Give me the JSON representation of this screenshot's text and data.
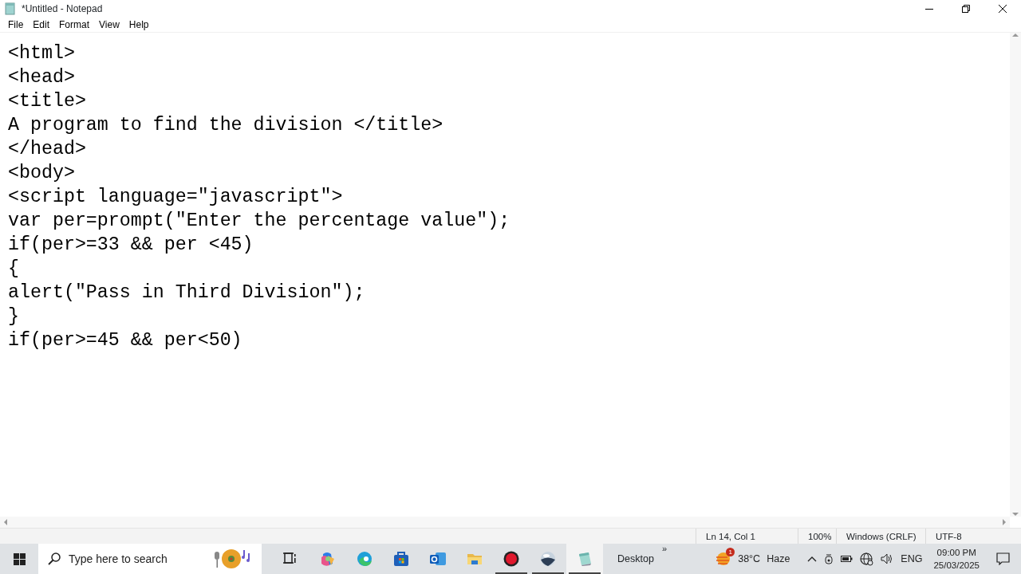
{
  "window": {
    "title": "*Untitled - Notepad"
  },
  "menu": [
    "File",
    "Edit",
    "Format",
    "View",
    "Help"
  ],
  "editor": {
    "lines": [
      "<html>",
      "<head>",
      "<title>",
      "A program to find the division </title>",
      "</head>",
      "<body>",
      "<script language=\"javascript\">",
      "var per=prompt(\"Enter the percentage value\");",
      "if(per>=33 && per <45)",
      "{",
      "alert(\"Pass in Third Division\");",
      "}",
      "if(per>=45 && per<50)"
    ]
  },
  "status_bar": [
    "Ln 14, Col 1",
    "100%",
    "Windows (CRLF)",
    "UTF-8"
  ],
  "taskbar": {
    "search": {
      "placeholder": "Type here to search"
    },
    "apps": [
      {
        "kind": "taskview",
        "running": false,
        "active": false
      },
      {
        "kind": "copilot",
        "running": false,
        "active": false
      },
      {
        "kind": "edge",
        "running": false,
        "active": false
      },
      {
        "kind": "store",
        "running": false,
        "active": false
      },
      {
        "kind": "outlook",
        "running": false,
        "active": false
      },
      {
        "kind": "folder",
        "running": false,
        "active": false
      },
      {
        "kind": "record",
        "running": true,
        "active": false
      },
      {
        "kind": "globe",
        "running": true,
        "active": false
      },
      {
        "kind": "notepad",
        "running": true,
        "active": true
      }
    ],
    "toolbar_label": "Desktop",
    "toolbar_chevron": "»",
    "weather": {
      "badge": "1",
      "temperature": "38°C",
      "condition": "Haze"
    },
    "language": "ENG",
    "time": "09:00 PM",
    "date": "25/03/2025"
  }
}
